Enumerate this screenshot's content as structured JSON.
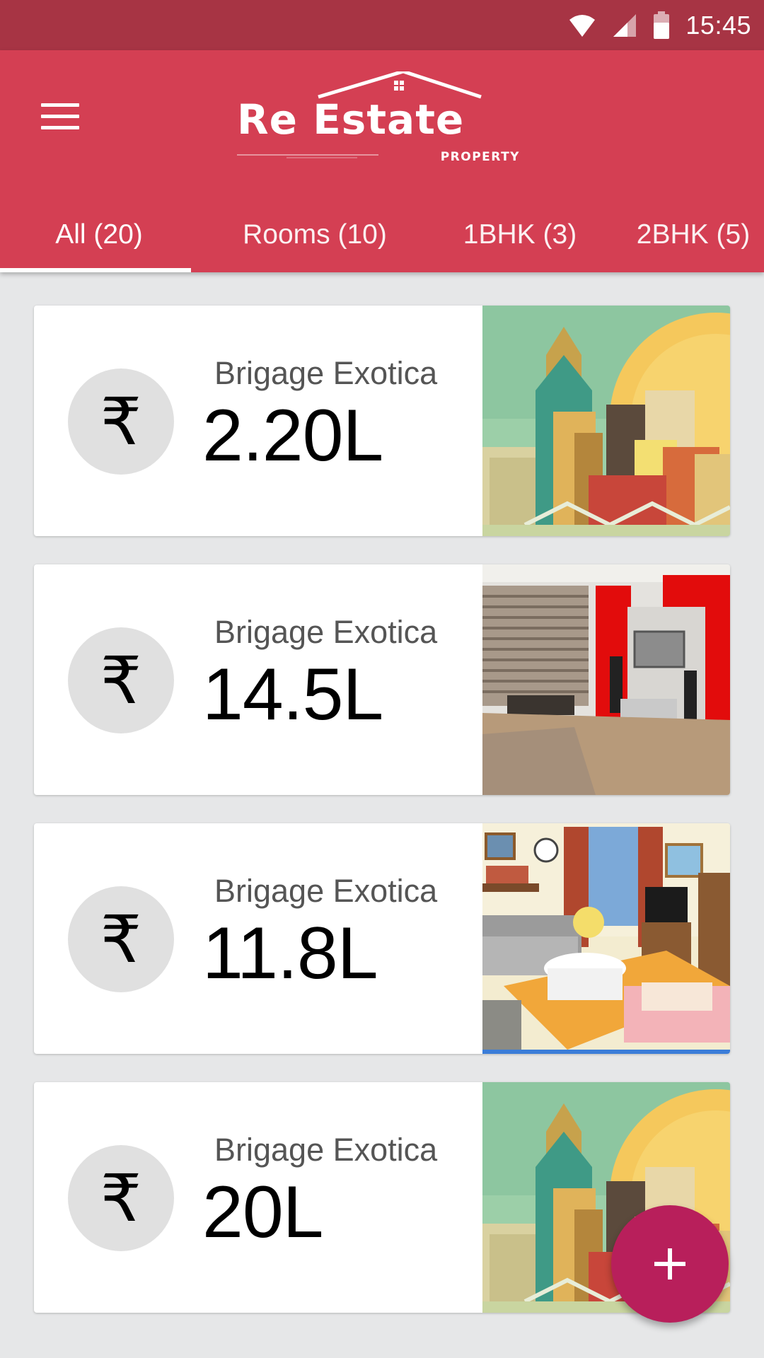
{
  "status_bar": {
    "time": "15:45",
    "icons": [
      "wifi-icon",
      "signal-icon",
      "battery-icon"
    ]
  },
  "app_bar": {
    "logo_text": "Re Estate",
    "logo_subtitle": "PROPERTY",
    "menu_icon": "menu-icon",
    "colors": {
      "primary": "#d43f53",
      "status": "#a73444",
      "accent": "#b81f5b"
    }
  },
  "tabs": [
    {
      "label": "All (20)",
      "active": true
    },
    {
      "label": "Rooms (10)",
      "active": false
    },
    {
      "label": "1BHK (3)",
      "active": false
    },
    {
      "label": "2BHK (5)",
      "active": false
    }
  ],
  "listings": [
    {
      "currency": "₹",
      "title": "Brigage Exotica",
      "price": "2.20L",
      "image": "city-skyline-illustration"
    },
    {
      "currency": "₹",
      "title": "Brigage Exotica",
      "price": "14.5L",
      "image": "living-room-photo"
    },
    {
      "currency": "₹",
      "title": "Brigage Exotica",
      "price": "11.8L",
      "image": "cartoon-living-room"
    },
    {
      "currency": "₹",
      "title": "Brigage Exotica",
      "price": "20L",
      "image": "city-skyline-illustration"
    }
  ],
  "fab": {
    "icon": "plus-icon",
    "symbol": "+"
  }
}
